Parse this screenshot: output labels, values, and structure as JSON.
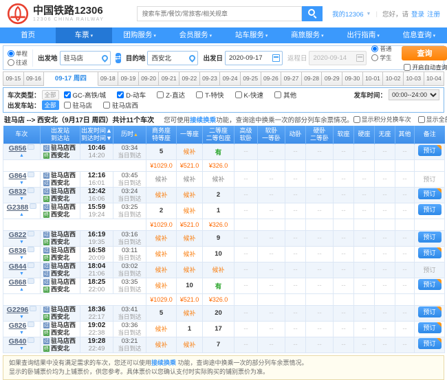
{
  "colors": {
    "accent": "#3b99fc",
    "nav_active": "#2478d6",
    "query_button": "#ff8201",
    "price": "#fd6a02",
    "waitlist": "#fa8114",
    "available": "#28a428",
    "table_header": "#4a99f1"
  },
  "header": {
    "logo_title": "中国铁路12306",
    "logo_subtitle": "12306 CHINA RAILWAY",
    "search_placeholder": "搜索车票/餐饮/常旅客/相关规章",
    "my12306": "我的12306",
    "greeting": "您好，请",
    "login": "登录",
    "register": "注册",
    "divider": "|"
  },
  "nav": {
    "active_index": 1,
    "items": [
      {
        "label": "首页",
        "arrow": false
      },
      {
        "label": "车票",
        "arrow": true
      },
      {
        "label": "团购服务",
        "arrow": true
      },
      {
        "label": "会员服务",
        "arrow": true
      },
      {
        "label": "站车服务",
        "arrow": true
      },
      {
        "label": "商旅服务",
        "arrow": true
      },
      {
        "label": "出行指南",
        "arrow": true
      },
      {
        "label": "信息查询",
        "arrow": true
      }
    ]
  },
  "form": {
    "trip_options": [
      {
        "label": "单程",
        "checked": true
      },
      {
        "label": "往返",
        "checked": false
      }
    ],
    "from_label": "出发地",
    "from_value": "驻马店",
    "to_label": "目的地",
    "to_value": "西安北",
    "depart_label": "出发日",
    "depart_value": "2020-09-17",
    "return_label": "返程日",
    "return_value": "2020-09-14",
    "passenger_options": [
      {
        "label": "普通",
        "checked": true
      },
      {
        "label": "学生",
        "checked": false
      }
    ],
    "submit_label": "查询",
    "auto_query_label": "开启自动查询"
  },
  "dates": {
    "selected_index": 2,
    "items": [
      "09-15",
      "09-16",
      "09-17 周四",
      "09-18",
      "09-19",
      "09-20",
      "09-21",
      "09-22",
      "09-23",
      "09-24",
      "09-25",
      "09-26",
      "09-27",
      "09-28",
      "09-29",
      "09-30",
      "10-01",
      "10-02",
      "10-03",
      "10-04"
    ]
  },
  "filters": {
    "type_label": "车次类型：",
    "type_all": "全部",
    "type_all_on": false,
    "types": [
      {
        "label": "GC-高铁/城",
        "checked": true
      },
      {
        "label": "D-动车",
        "checked": true
      },
      {
        "label": "Z-直达",
        "checked": false
      },
      {
        "label": "T-特快",
        "checked": false
      },
      {
        "label": "K-快速",
        "checked": false
      },
      {
        "label": "其他",
        "checked": false
      }
    ],
    "time_label": "发车时间：",
    "time_value": "00:00--24:00",
    "station_label": "出发车站：",
    "station_all": "全部",
    "station_all_on": true,
    "stations": [
      {
        "label": "驻马店",
        "checked": false
      },
      {
        "label": "驻马店西",
        "checked": false
      }
    ]
  },
  "summary": {
    "route": "驻马店 --> 西安北（9月17日 周四）共计11个车次",
    "tip_pre": "您可使用",
    "tip_link": "接续换乘",
    "tip_post": "功能，查询途中换乘一次的部分列车余票情况。",
    "check1": "显示积分兑换车次",
    "check2": "显示全部可预订车次"
  },
  "table": {
    "book_label": "预订",
    "station_icons": {
      "pass": "过",
      "terminal": "终"
    },
    "headers": [
      {
        "lines": [
          "车次"
        ]
      },
      {
        "lines": [
          "出发站",
          "到达站"
        ]
      },
      {
        "lines": [
          "出发时间▲",
          "到达时间▼"
        ]
      },
      {
        "lines": [
          "历时"
        ],
        "sort": "▲"
      },
      {
        "lines": [
          "商务座",
          "特等座"
        ]
      },
      {
        "lines": [
          "一等座"
        ]
      },
      {
        "lines": [
          "二等座",
          "二等包座"
        ]
      },
      {
        "lines": [
          "高级",
          "软卧"
        ]
      },
      {
        "lines": [
          "软卧",
          "一等卧"
        ]
      },
      {
        "lines": [
          "动卧"
        ]
      },
      {
        "lines": [
          "硬卧",
          "二等卧"
        ]
      },
      {
        "lines": [
          "软座"
        ]
      },
      {
        "lines": [
          "硬座"
        ]
      },
      {
        "lines": [
          "无座"
        ]
      },
      {
        "lines": [
          "其他"
        ]
      },
      {
        "lines": [
          "备注"
        ]
      }
    ],
    "trains": [
      {
        "code": "G856",
        "expanded": true,
        "from": "驻马店西",
        "to": "西安北",
        "to_pass": false,
        "dep": "10:46",
        "arr": "14:20",
        "dur": "03:34",
        "day": "当日到达",
        "seats": [
          "5",
          "候补",
          "有",
          "--",
          "--",
          "--",
          "--",
          "--",
          "--",
          "--",
          "--"
        ],
        "prices": [
          "¥1029.0",
          "¥521.0",
          "¥326.0"
        ],
        "book": "corner",
        "hb_grey": false
      },
      {
        "code": "G864",
        "expanded": false,
        "from": "驻马店西",
        "to": "西安北",
        "to_pass": true,
        "dep": "12:16",
        "arr": "16:01",
        "dur": "03:45",
        "day": "当日到达",
        "seats": [
          "候补",
          "候补",
          "候补",
          "--",
          "--",
          "--",
          "--",
          "--",
          "--",
          "--",
          "--"
        ],
        "book": "disabled",
        "hb_grey": true
      },
      {
        "code": "G832",
        "expanded": false,
        "from": "驻马店西",
        "to": "西安北",
        "to_pass": false,
        "dep": "12:42",
        "arr": "16:06",
        "dur": "03:24",
        "day": "当日到达",
        "seats": [
          "候补",
          "候补",
          "2",
          "--",
          "--",
          "--",
          "--",
          "--",
          "--",
          "--",
          "--"
        ],
        "book": "corner",
        "hb_grey": false
      },
      {
        "code": "G2388",
        "expanded": true,
        "from": "驻马店西",
        "to": "西安北",
        "to_pass": false,
        "dep": "15:59",
        "arr": "19:24",
        "dur": "03:25",
        "day": "当日到达",
        "seats": [
          "2",
          "候补",
          "1",
          "--",
          "--",
          "--",
          "--",
          "--",
          "--",
          "--",
          "--"
        ],
        "prices": [
          "¥1029.0",
          "¥521.0",
          "¥326.0"
        ],
        "book": "plain",
        "hb_grey": false
      },
      {
        "code": "G822",
        "expanded": false,
        "from": "驻马店西",
        "to": "西安北",
        "to_pass": false,
        "dep": "16:19",
        "arr": "19:35",
        "dur": "03:16",
        "day": "当日到达",
        "seats": [
          "候补",
          "候补",
          "9",
          "--",
          "--",
          "--",
          "--",
          "--",
          "--",
          "--",
          "--"
        ],
        "book": "plain",
        "hb_grey": false
      },
      {
        "code": "G836",
        "expanded": false,
        "from": "驻马店西",
        "to": "西安北",
        "to_pass": false,
        "dep": "16:58",
        "arr": "20:09",
        "dur": "03:11",
        "day": "当日到达",
        "seats": [
          "候补",
          "候补",
          "10",
          "--",
          "--",
          "--",
          "--",
          "--",
          "--",
          "--",
          "--"
        ],
        "book": "corner",
        "hb_grey": false
      },
      {
        "code": "G844",
        "expanded": false,
        "from": "驻马店西",
        "to": "西安北",
        "to_pass": true,
        "dep": "18:04",
        "arr": "21:06",
        "dur": "03:02",
        "day": "当日到达",
        "seats": [
          "候补",
          "候补",
          "候补",
          "--",
          "--",
          "--",
          "--",
          "--",
          "--",
          "--",
          "--"
        ],
        "book": "disabled",
        "hb_grey": false
      },
      {
        "code": "G868",
        "expanded": true,
        "from": "驻马店西",
        "to": "西安北",
        "to_pass": false,
        "dep": "18:25",
        "arr": "22:00",
        "dur": "03:35",
        "day": "当日到达",
        "seats": [
          "候补",
          "10",
          "有",
          "--",
          "--",
          "--",
          "--",
          "--",
          "--",
          "--",
          "--"
        ],
        "prices": [
          "¥1029.0",
          "¥521.0",
          "¥326.0"
        ],
        "book": "corner",
        "hb_grey": false
      },
      {
        "code": "G2296",
        "expanded": false,
        "from": "驻马店西",
        "to": "西安北",
        "to_pass": false,
        "dep": "18:36",
        "arr": "22:17",
        "dur": "03:41",
        "day": "当日到达",
        "seats": [
          "5",
          "候补",
          "20",
          "--",
          "--",
          "--",
          "--",
          "--",
          "--",
          "--",
          "--"
        ],
        "book": "corner",
        "hb_grey": false
      },
      {
        "code": "G826",
        "expanded": false,
        "from": "驻马店西",
        "to": "西安北",
        "to_pass": false,
        "dep": "19:02",
        "arr": "22:38",
        "dur": "03:36",
        "day": "当日到达",
        "seats": [
          "候补",
          "1",
          "17",
          "--",
          "--",
          "--",
          "--",
          "--",
          "--",
          "--",
          "--"
        ],
        "book": "corner",
        "hb_grey": false
      },
      {
        "code": "G840",
        "expanded": false,
        "from": "驻马店西",
        "to": "西安北",
        "to_pass": false,
        "dep": "19:28",
        "arr": "22:49",
        "dur": "03:21",
        "day": "当日到达",
        "seats": [
          "候补",
          "候补",
          "7",
          "--",
          "--",
          "--",
          "--",
          "--",
          "--",
          "--",
          "--"
        ],
        "book": "corner",
        "hb_grey": false
      }
    ]
  },
  "footer": {
    "line1_pre": "如果查询结果中没有满足需求的车次，您还可以使用",
    "line1_link": "接续换乘",
    "line1_post": " 功能，查询途中换乘一次的部分列车余票情况。",
    "line2": "显示的卧铺票价均为上铺票价，供您参考。具体票价以您确认支付时实际购买的铺别票价为准。"
  }
}
